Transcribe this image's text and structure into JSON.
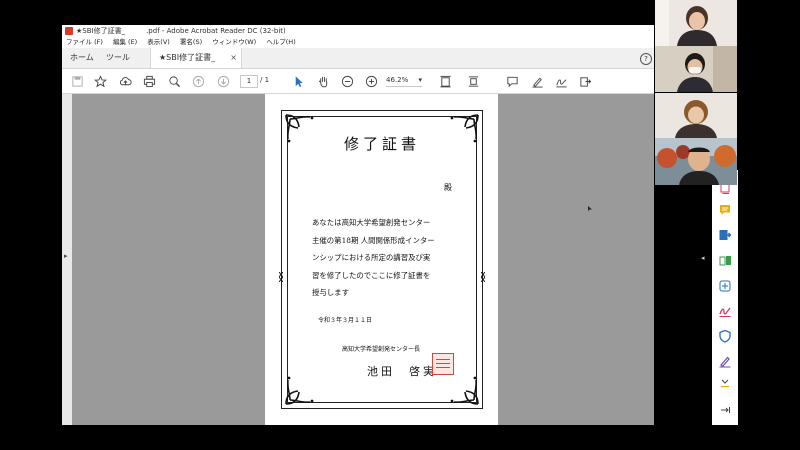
{
  "window": {
    "title": "★SBI修了証書_　　　.pdf - Adobe Acrobat Reader DC (32-bit)"
  },
  "menu": {
    "items": [
      "ファイル (F)",
      "編集 (E)",
      "表示(V)",
      "署名(S)",
      "ウィンドウ(W)",
      "ヘルプ(H)"
    ]
  },
  "tabs": {
    "home": "ホーム",
    "tools": "ツール",
    "document": "★SBI修了証書_",
    "close": "×",
    "help": "?"
  },
  "toolbar": {
    "page_current": "1",
    "page_total": "/ 1",
    "zoom": "46.2%",
    "zoom_arrow": "▾"
  },
  "certificate": {
    "title": "修了証書",
    "honorific": "殿",
    "body_lines": [
      "あなたは高知大学希望創発センター",
      "主催の第18期 人間関係形成インター",
      "ンシップにおける所定の講習及び実",
      "習を修了したのでここに修了証書を",
      "授与します"
    ],
    "date": "令和３年３月１１日",
    "organization": "高知大学希望創発センター長",
    "signatory": "池田　啓実"
  },
  "colors": {
    "acrobat_red": "#d83b2d",
    "tool_blue": "#2a6ebd",
    "rail_pink": "#d9345f",
    "rail_yellow": "#e8b000",
    "rail_blue": "#2a6ebd",
    "rail_green": "#3a9b4a",
    "rail_purple": "#6c4ab5",
    "seal_red": "#cc4a3a"
  },
  "icons": {
    "toolbar": [
      "save-icon",
      "bookmark-star-icon",
      "upload-cloud-icon",
      "print-icon",
      "find-icon",
      "page-up-icon",
      "page-down-icon",
      "select-arrow-icon",
      "hand-icon",
      "zoom-out-icon",
      "zoom-in-icon",
      "fit-page-icon",
      "scroll-mode-icon",
      "comment-icon",
      "highlight-pen-icon",
      "sign-icon",
      "share-icon"
    ],
    "rail": [
      "pdf-export-icon",
      "comment-icon",
      "export-pdf-icon",
      "organize-pages-icon",
      "compress-icon",
      "fill-sign-icon",
      "protect-icon",
      "edit-icon",
      "more-tools-icon",
      "collapse-icon"
    ]
  }
}
